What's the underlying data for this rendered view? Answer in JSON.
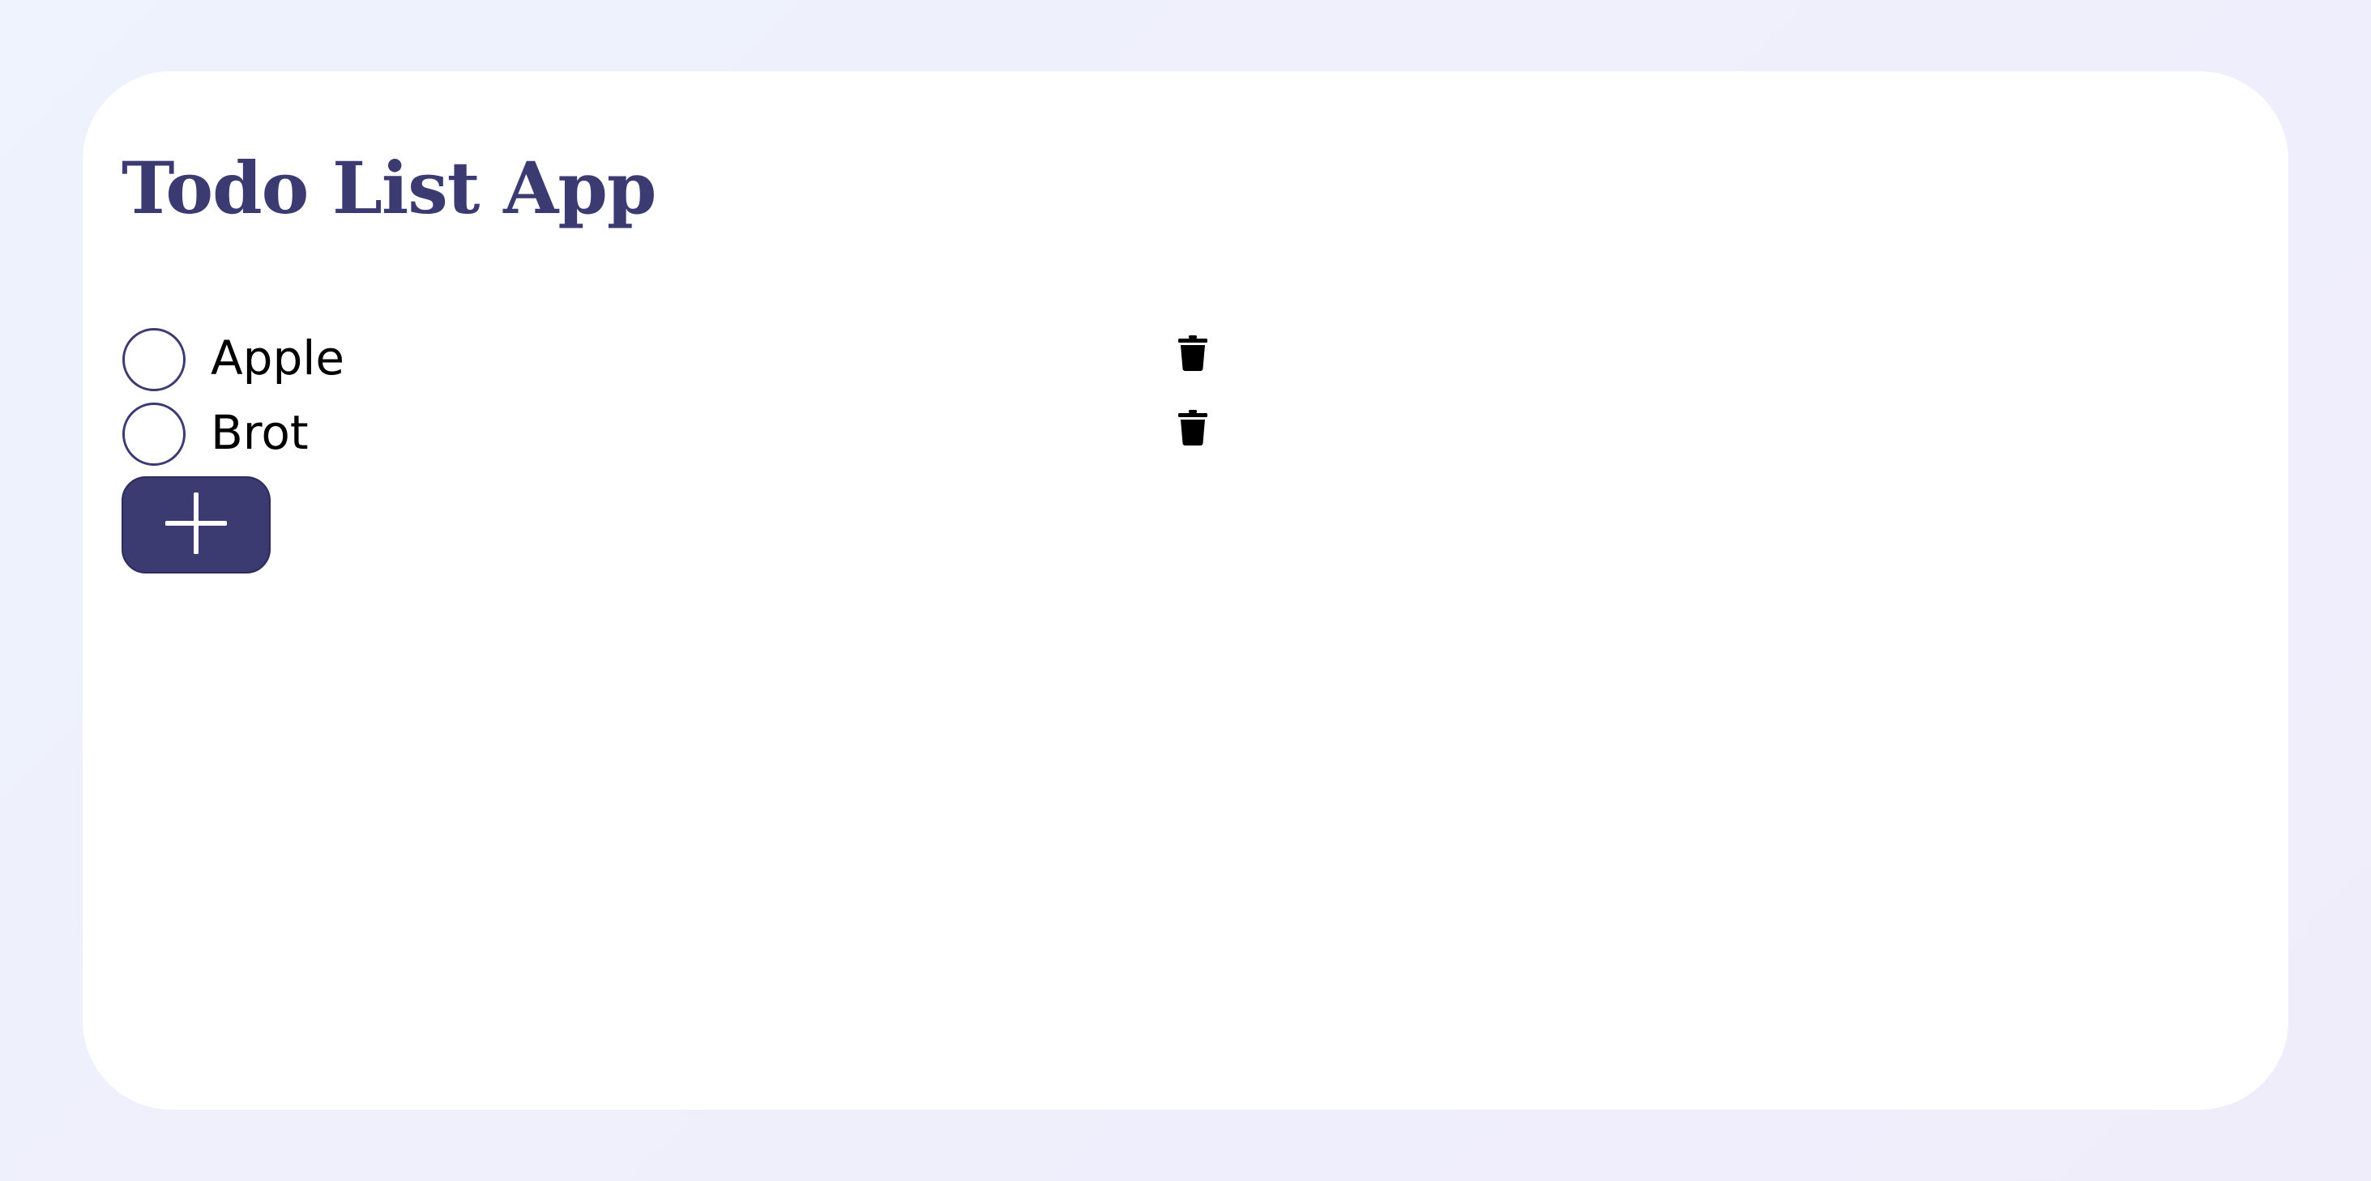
{
  "app": {
    "title": "Todo List App"
  },
  "todos": [
    {
      "label": "Apple",
      "done": false
    },
    {
      "label": "Brot",
      "done": false
    }
  ],
  "controls": {
    "add_icon": "plus-icon",
    "delete_icon": "trash-icon",
    "check_icon": "circle-outline-icon"
  },
  "colors": {
    "accent": "#3b3b72",
    "background": "#eef0fc",
    "card": "#ffffff"
  }
}
